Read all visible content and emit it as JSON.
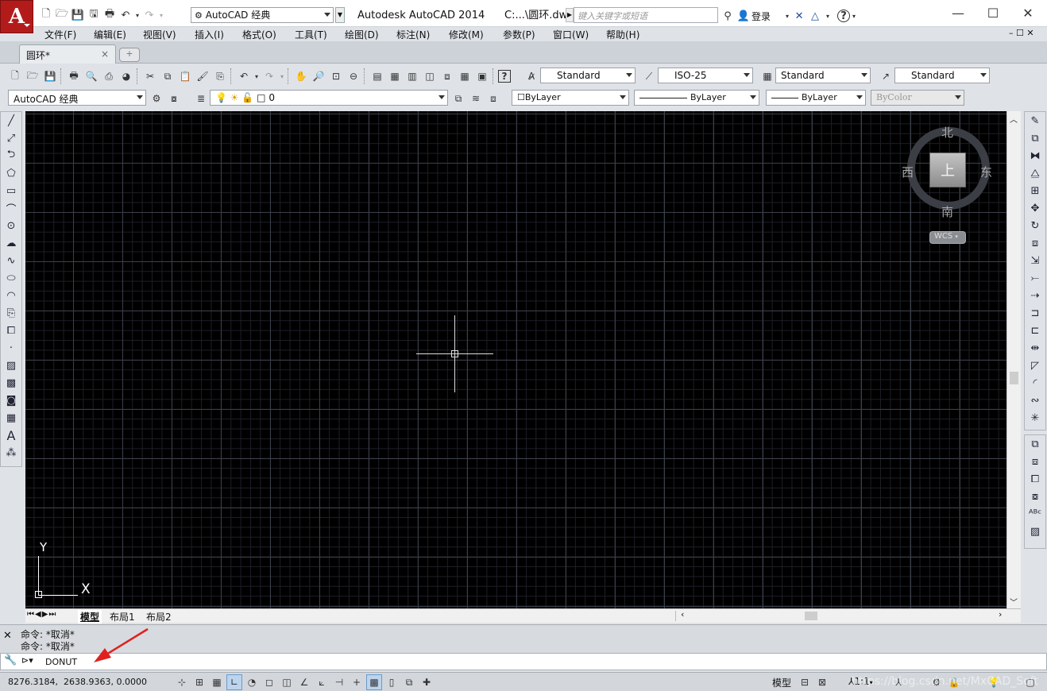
{
  "app_icon": "A",
  "title": {
    "product": "Autodesk AutoCAD 2014",
    "file": "C:...\\圆环.dwg"
  },
  "workspace": "AutoCAD 经典",
  "search_placeholder": "键入关键字或短语",
  "login": "登录",
  "menus": [
    "文件(F)",
    "编辑(E)",
    "视图(V)",
    "插入(I)",
    "格式(O)",
    "工具(T)",
    "绘图(D)",
    "标注(N)",
    "修改(M)",
    "参数(P)",
    "窗口(W)",
    "帮助(H)"
  ],
  "file_tab": "圆环*",
  "styles": {
    "text": "Standard",
    "dim": "ISO-25",
    "table": "Standard",
    "mleader": "Standard"
  },
  "workspace2": "AutoCAD 经典",
  "layer": "0",
  "props": {
    "color": "ByLayer",
    "linetype": "ByLayer",
    "lineweight": "ByLayer",
    "plotstyle": "ByColor"
  },
  "viewcube": {
    "north": "北",
    "south": "南",
    "east": "东",
    "west": "西",
    "face": "上",
    "wcs": "WCS"
  },
  "ucs": {
    "x": "X",
    "y": "Y"
  },
  "layout_tabs": [
    "模型",
    "布局1",
    "布局2"
  ],
  "history": [
    "命令: *取消*",
    "命令: *取消*"
  ],
  "command_input": "DONUT",
  "coords": "8276.3184,  2638.9363, 0.0000",
  "status_right": {
    "space": "模型",
    "scale": "1:1",
    "watermark": "https://blog.csdn.net/MxCAD_Soft"
  },
  "colors": {
    "canvas": "#000000",
    "grid_major": "#3a3f48",
    "arrow": "#e02020"
  }
}
